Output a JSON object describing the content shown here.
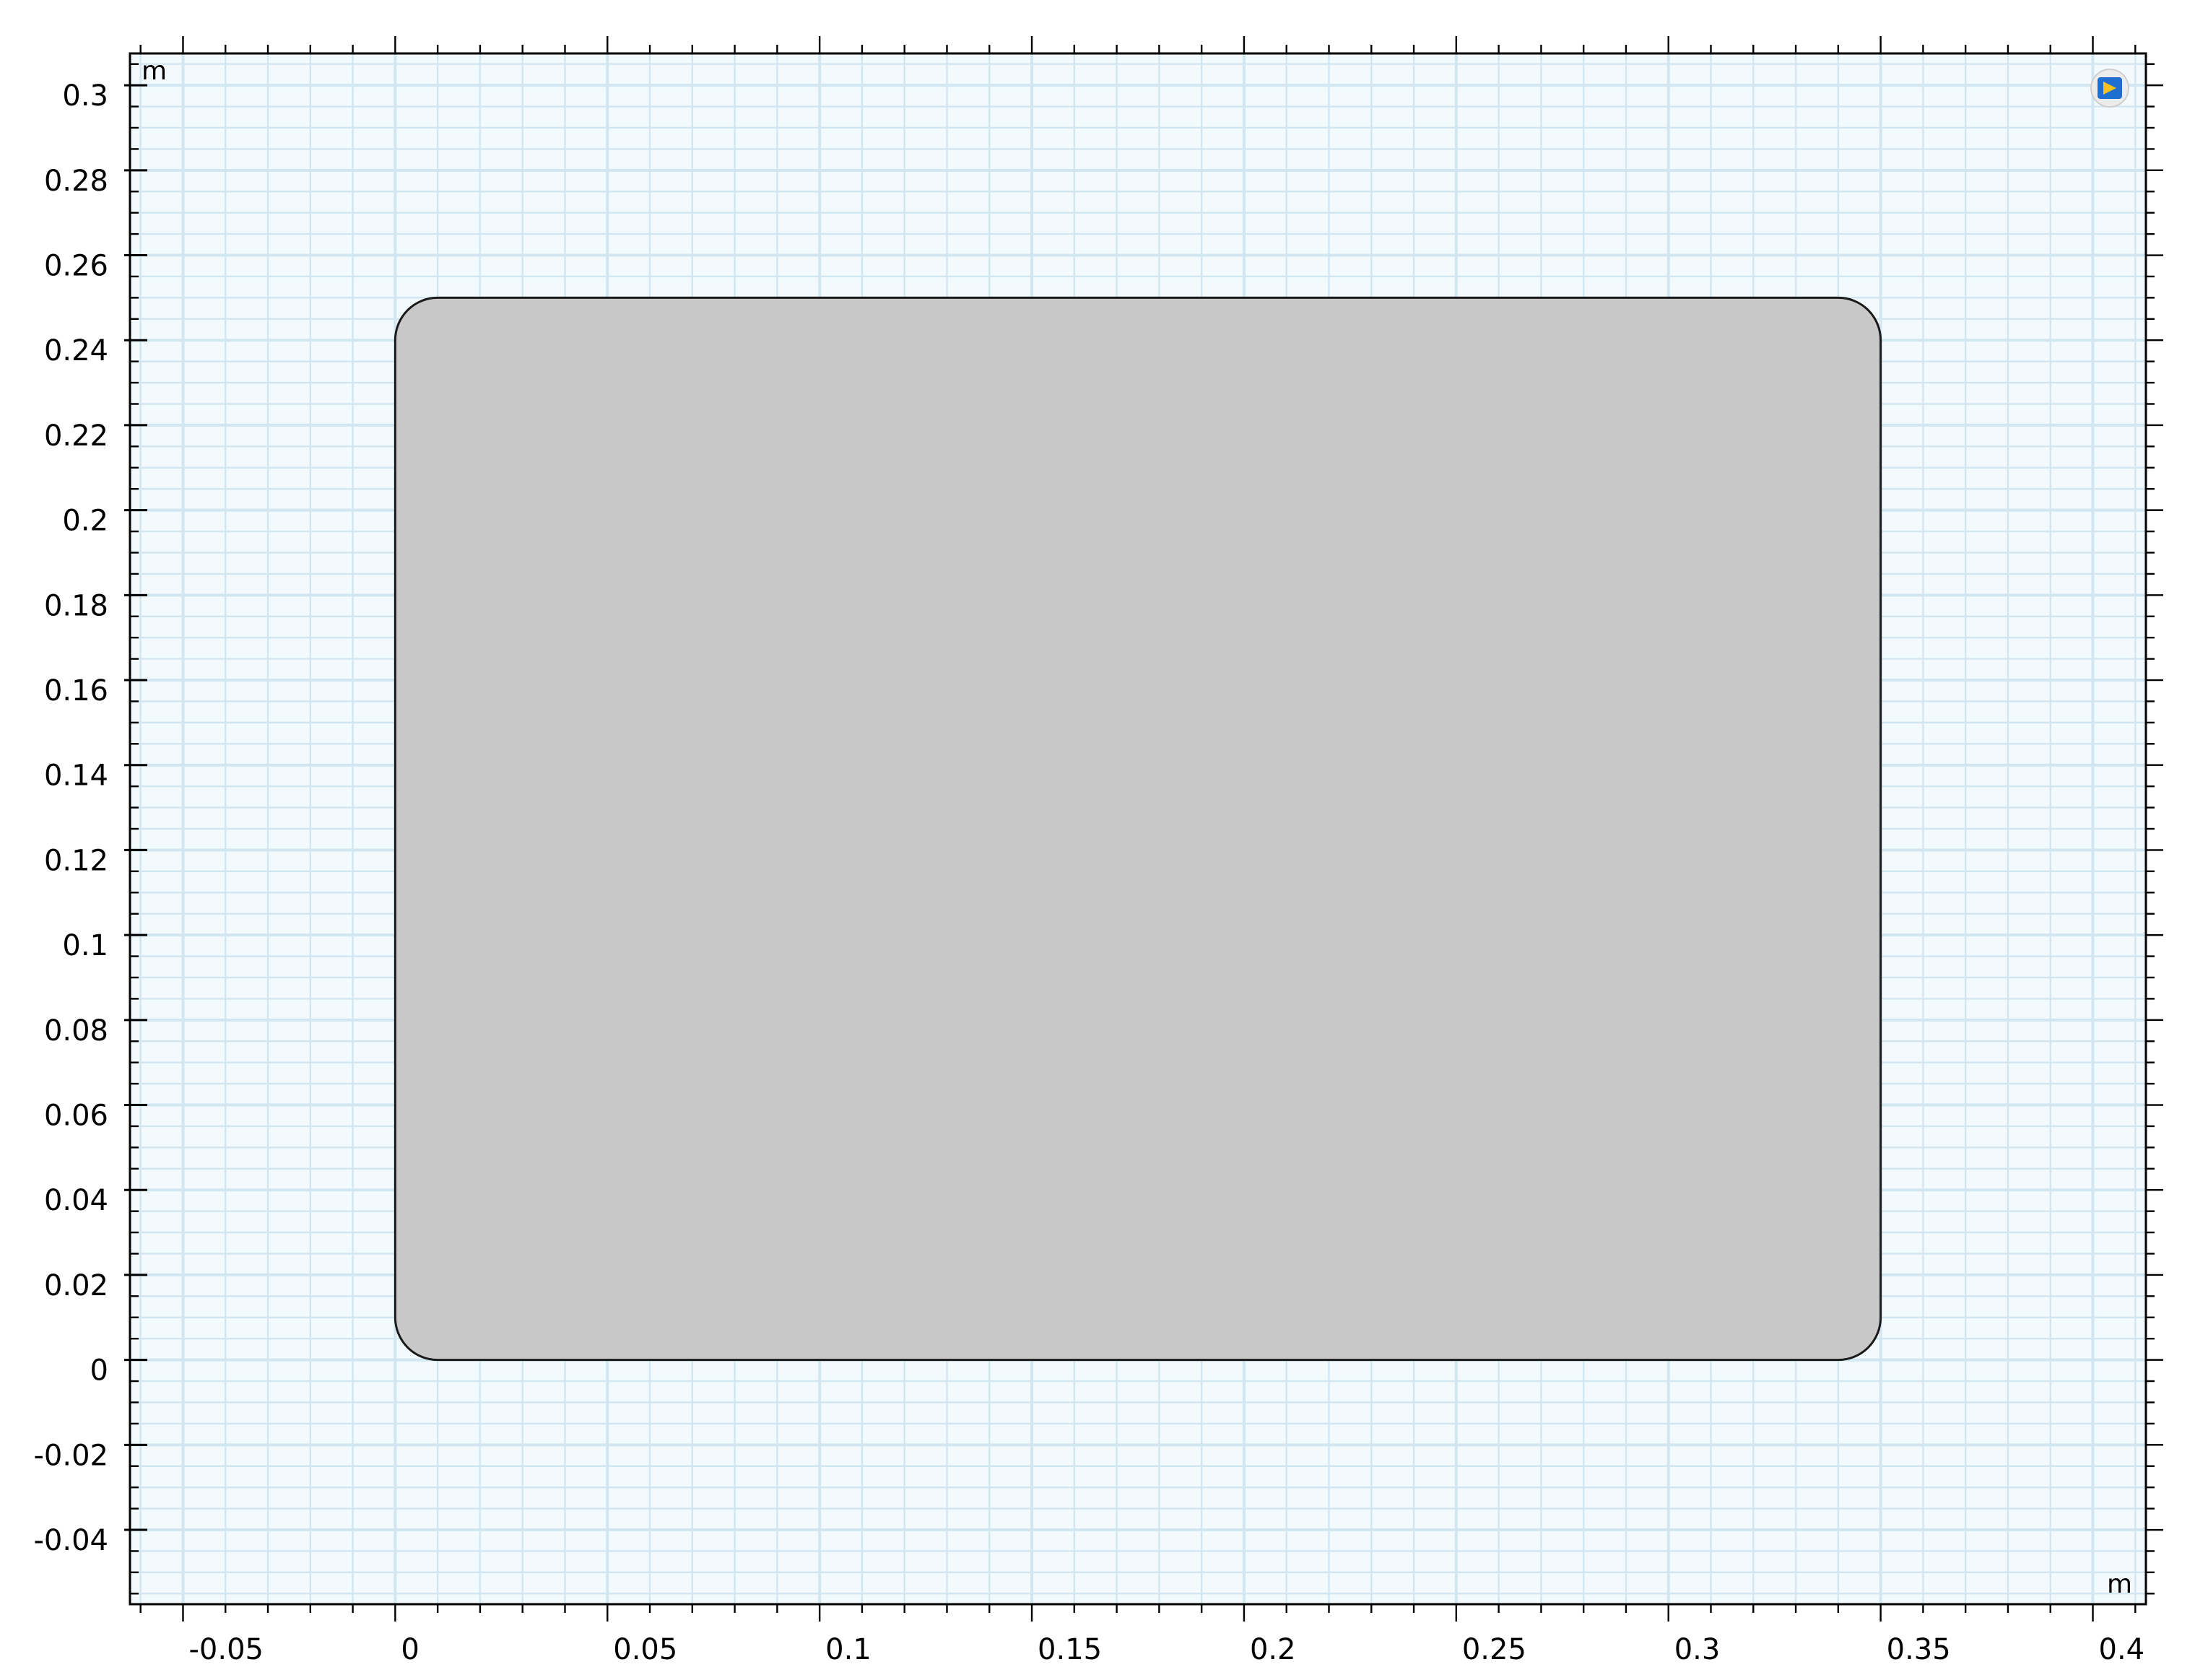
{
  "viewport": {
    "x_unit": "m",
    "y_unit": "m",
    "x_range": [
      -0.0625,
      0.4125
    ],
    "y_range": [
      -0.0575,
      0.3075
    ],
    "x_ticks": [
      {
        "value": -0.05,
        "label": "-0.05"
      },
      {
        "value": 0,
        "label": "0"
      },
      {
        "value": 0.05,
        "label": "0.05"
      },
      {
        "value": 0.1,
        "label": "0.1"
      },
      {
        "value": 0.15,
        "label": "0.15"
      },
      {
        "value": 0.2,
        "label": "0.2"
      },
      {
        "value": 0.25,
        "label": "0.25"
      },
      {
        "value": 0.3,
        "label": "0.3"
      },
      {
        "value": 0.35,
        "label": "0.35"
      },
      {
        "value": 0.4,
        "label": "0.4"
      }
    ],
    "y_ticks": [
      {
        "value": 0.3,
        "label": "0.3"
      },
      {
        "value": 0.28,
        "label": "0.28"
      },
      {
        "value": 0.26,
        "label": "0.26"
      },
      {
        "value": 0.24,
        "label": "0.24"
      },
      {
        "value": 0.22,
        "label": "0.22"
      },
      {
        "value": 0.2,
        "label": "0.2"
      },
      {
        "value": 0.18,
        "label": "0.18"
      },
      {
        "value": 0.16,
        "label": "0.16"
      },
      {
        "value": 0.14,
        "label": "0.14"
      },
      {
        "value": 0.12,
        "label": "0.12"
      },
      {
        "value": 0.1,
        "label": "0.1"
      },
      {
        "value": 0.08,
        "label": "0.08"
      },
      {
        "value": 0.06,
        "label": "0.06"
      },
      {
        "value": 0.04,
        "label": "0.04"
      },
      {
        "value": 0.02,
        "label": "0.02"
      },
      {
        "value": 0,
        "label": "0"
      },
      {
        "value": -0.02,
        "label": "-0.02"
      },
      {
        "value": -0.04,
        "label": "-0.04"
      }
    ],
    "grid": true,
    "colors": {
      "background": "#f3fafd",
      "grid": "#d2e6f2",
      "frame": "#000000",
      "geometry_fill": "#c8c8c8",
      "geometry_edge": "#1a1a1a"
    }
  },
  "geometry": {
    "shape": "rounded-rectangle",
    "x_min": 0,
    "x_max": 0.35,
    "y_min": 0,
    "y_max": 0.25,
    "corner_radius": 0.01
  },
  "toolbar": {
    "axis_orientation_icon": "axis-orientation-icon"
  }
}
